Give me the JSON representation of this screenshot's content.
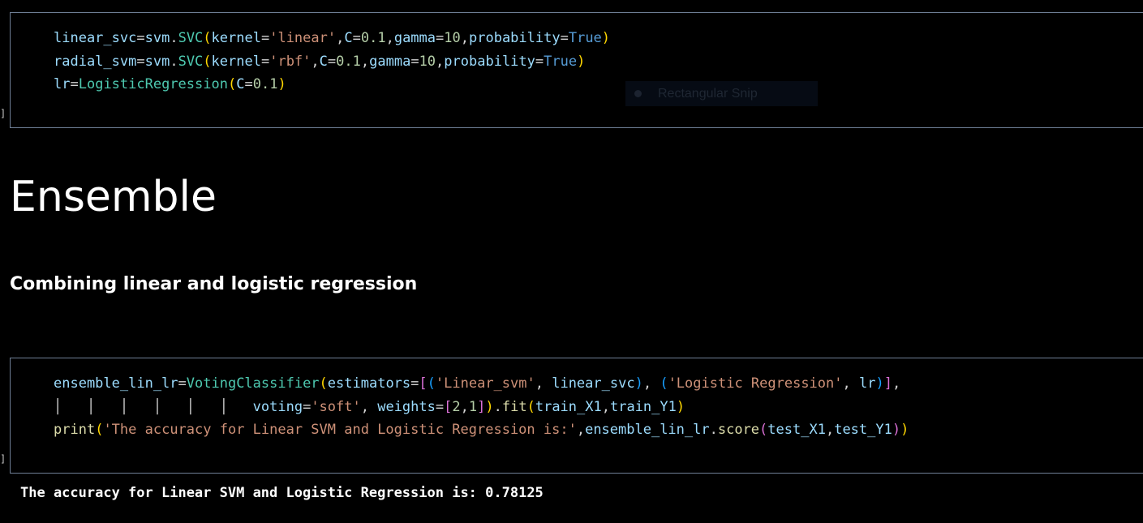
{
  "cell1": {
    "prompt": "]",
    "lines": {
      "l1": {
        "a": "linear_svc",
        "b": "=",
        "c": "svm",
        "d": ".",
        "e": "SVC",
        "f": "(",
        "g": "kernel",
        "h": "=",
        "i": "'linear'",
        "j": ",",
        "k": "C",
        "l": "=",
        "m": "0.1",
        "n": ",",
        "o": "gamma",
        "p": "=",
        "q": "10",
        "r": ",",
        "s": "probability",
        "t": "=",
        "u": "True",
        "v": ")"
      },
      "l2": {
        "a": "radial_svm",
        "b": "=",
        "c": "svm",
        "d": ".",
        "e": "SVC",
        "f": "(",
        "g": "kernel",
        "h": "=",
        "i": "'rbf'",
        "j": ",",
        "k": "C",
        "l": "=",
        "m": "0.1",
        "n": ",",
        "o": "gamma",
        "p": "=",
        "q": "10",
        "r": ",",
        "s": "probability",
        "t": "=",
        "u": "True",
        "v": ")"
      },
      "l3": {
        "a": "lr",
        "b": "=",
        "c": "LogisticRegression",
        "d": "(",
        "e": "C",
        "f": "=",
        "g": "0.1",
        "h": ")"
      }
    }
  },
  "snip_overlay": {
    "label": "Rectangular Snip",
    "icon": "record-dot-icon"
  },
  "heading": "Ensemble",
  "subheading": "Combining linear and logistic regression",
  "cell2": {
    "prompt": "]",
    "lines": {
      "l1": {
        "a": "ensemble_lin_lr",
        "b": "=",
        "c": "VotingClassifier",
        "d": "(",
        "e": "estimators",
        "f": "=",
        "g": "[",
        "h": "(",
        "i": "'Linear_svm'",
        "j": ", ",
        "k": "linear_svc",
        "l": ")",
        "m": ", ",
        "n": "(",
        "o": "'Logistic Regression'",
        "p": ", ",
        "q": "lr",
        "r": ")",
        "s": "]",
        "t": ","
      },
      "l2": {
        "guides": "│   │   │   │   │   │   ",
        "a": "voting",
        "b": "=",
        "c": "'soft'",
        "d": ", ",
        "e": "weights",
        "f": "=",
        "g": "[",
        "h": "2",
        "i": ",",
        "j": "1",
        "k": "]",
        "l": ")",
        "m": ".",
        "n": "fit",
        "o": "(",
        "p": "train_X1",
        "q": ",",
        "r": "train_Y1",
        "s": ")"
      },
      "l3": {
        "a": "print",
        "b": "(",
        "c": "'The accuracy for Linear SVM and Logistic Regression is:'",
        "d": ",",
        "e": "ensemble_lin_lr",
        "f": ".",
        "g": "score",
        "h": "(",
        "i": "test_X1",
        "j": ",",
        "k": "test_Y1",
        "l": ")",
        "m": ")"
      }
    }
  },
  "output": "The accuracy for Linear SVM and Logistic Regression is: 0.78125",
  "colors": {
    "background": "#000000",
    "cell_border": "#6f7f96",
    "variable": "#9cdcfe",
    "class": "#4ec9b0",
    "function": "#dcdcaa",
    "string": "#ce9178",
    "number": "#b5cea8",
    "keyword": "#569cd6",
    "bracket_level1": "#ffd700",
    "bracket_level2": "#da70d6",
    "bracket_level3": "#179fff"
  }
}
